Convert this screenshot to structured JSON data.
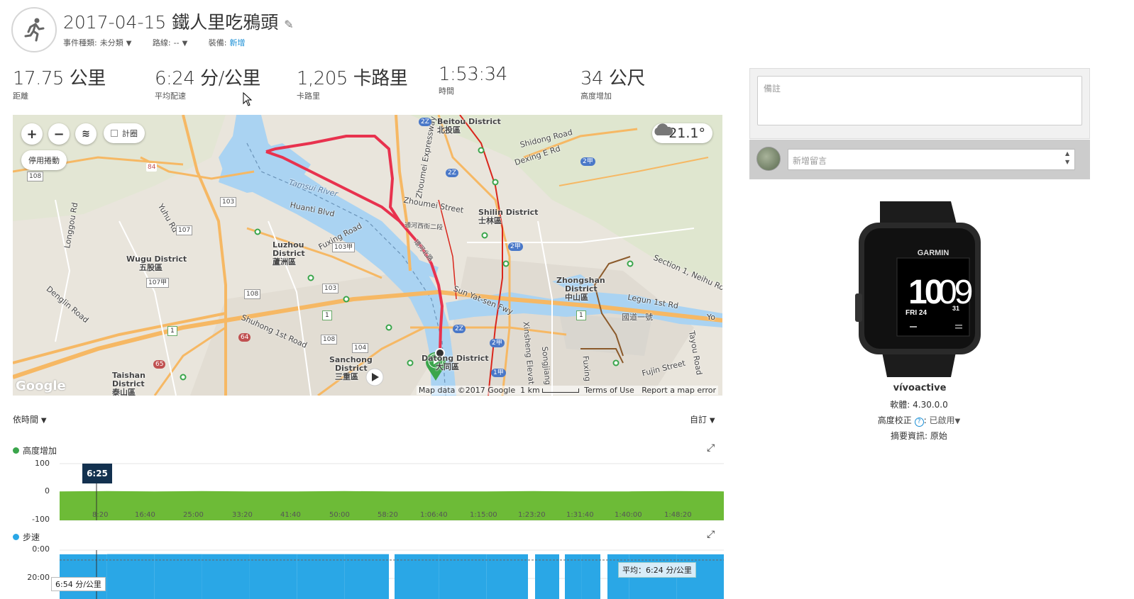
{
  "activity": {
    "title": "2017-04-15 鐵人里吃鴉頭",
    "event_type_label": "事件種類:",
    "event_type_value": "未分類",
    "route_label": "路線:",
    "route_value": "--",
    "gear_label": "裝備:",
    "gear_value": "新增"
  },
  "stats": [
    {
      "value": "17.75 公里",
      "label": "距離"
    },
    {
      "value": "6:24 分/公里",
      "label": "平均配速"
    },
    {
      "value": "1,205 卡路里",
      "label": "卡路里"
    },
    {
      "value": "1:53:34",
      "label": "時間"
    },
    {
      "value": "34 公尺",
      "label": "高度增加"
    }
  ],
  "map": {
    "checkbox_label": "計圈",
    "disable_scroll_label": "停用捲動",
    "weather_temp": "21.1°",
    "footer_data": "Map data ©2017 Google",
    "footer_scale": "1 km",
    "footer_terms": "Terms of Use",
    "footer_report": "Report a map error",
    "google_logo": "Google",
    "places": [
      {
        "name": "Beitou District",
        "sub": "北投區"
      },
      {
        "name": "Shilin District",
        "sub": "士林區"
      },
      {
        "name": "Luzhou",
        "sub": "District"
      },
      {
        "name": "蘆洲區",
        "sub": ""
      },
      {
        "name": "Wugu District",
        "sub": "五股區"
      },
      {
        "name": "Zhongshan",
        "sub": "District"
      },
      {
        "name": "中山區",
        "sub": ""
      },
      {
        "name": "Sanchong",
        "sub": "District"
      },
      {
        "name": "三重區",
        "sub": ""
      },
      {
        "name": "Taishan",
        "sub": "District"
      },
      {
        "name": "泰山區",
        "sub": ""
      },
      {
        "name": "Datong District",
        "sub": "大同區"
      }
    ],
    "roads": [
      "Tamsui River",
      "Huanti Blvd",
      "Fuxing Road",
      "Sun Yat-sen Fwy",
      "Zhoumei Street",
      "Zhoumei Expressway",
      "Shidong Road",
      "Dexing E Rd",
      "Shuhong 1st Road",
      "Denglin Road",
      "Longgou Rd",
      "Yuhu Rd",
      "Xinsheng Elevat",
      "Songjiang",
      "Fuxing",
      "Legun 1st Rd",
      "Section 1, Neihu Road",
      "國道一號",
      "Fujin Street",
      "Tayou Road",
      "通河西街二段",
      "環河北路",
      "Yo"
    ],
    "road_shields": [
      "84",
      "108",
      "103",
      "107",
      "107甲",
      "108",
      "103甲",
      "103",
      "108",
      "104",
      "65",
      "64",
      "2Z",
      "2Z",
      "2甲",
      "2Z",
      "2甲",
      "1甲",
      "2甲",
      "1",
      "1",
      "1"
    ]
  },
  "chart_controls": {
    "x_mode": "依時間",
    "customize": "自訂"
  },
  "elevation_chart": {
    "title": "高度增加",
    "color": "#5fb832",
    "cursor_label": "6:25",
    "y_ticks": [
      "100",
      "0",
      "-100"
    ],
    "x_ticks": [
      "8:20",
      "16:40",
      "25:00",
      "33:20",
      "41:40",
      "50:00",
      "58:20",
      "1:06:40",
      "1:15:00",
      "1:23:20",
      "1:31:40",
      "1:40:00",
      "1:48:20"
    ]
  },
  "pace_chart": {
    "title": "步速",
    "color": "#2aa7e6",
    "y_ticks": [
      "0:00",
      "20:00"
    ],
    "avg_label": "平均：6:24 分/公里",
    "cursor_label": "6:54 分/公里"
  },
  "chart_data": [
    {
      "type": "area",
      "title": "高度增加",
      "xlabel": "",
      "ylabel": "",
      "ylim": [
        -100,
        100
      ],
      "x": [
        "0:00",
        "8:20",
        "16:40",
        "25:00",
        "33:20",
        "41:40",
        "50:00",
        "58:20",
        "1:06:40",
        "1:15:00",
        "1:23:20",
        "1:31:40",
        "1:40:00",
        "1:48:20",
        "1:53:34"
      ],
      "series": [
        {
          "name": "高度增加",
          "values": [
            2,
            3,
            2,
            3,
            2,
            2,
            3,
            2,
            2,
            2,
            3,
            2,
            2,
            3,
            2
          ]
        }
      ]
    },
    {
      "type": "area",
      "title": "步速",
      "xlabel": "",
      "ylabel": "",
      "ylim": [
        "0:00",
        "20:00"
      ],
      "x": [
        "0:00",
        "8:20",
        "16:40",
        "25:00",
        "33:20",
        "41:40",
        "50:00",
        "58:20",
        "1:06:40",
        "1:15:00",
        "1:23:20",
        "1:31:40",
        "1:40:00",
        "1:48:20",
        "1:53:34"
      ],
      "series": [
        {
          "name": "步速",
          "values": [
            "6:54",
            "6:20",
            "6:15",
            "6:20",
            "6:18",
            "6:22",
            "6:20",
            "6:24",
            "6:30",
            "6:28",
            "6:35",
            "6:40",
            "6:30",
            "6:38",
            "6:45"
          ]
        }
      ],
      "average": "6:24 分/公里"
    }
  ],
  "notes": {
    "placeholder": "備註"
  },
  "comment": {
    "placeholder": "新增留言"
  },
  "device": {
    "name": "vívoactive",
    "brand": "GARMIN",
    "watch_time_h": "10",
    "watch_time_m": "09",
    "watch_date": "FRI 24",
    "watch_sec": "31",
    "firmware_label": "軟體:",
    "firmware_value": "4.30.0.0",
    "elev_corr_label": "高度校正",
    "elev_corr_value": "已啟用",
    "summary_label": "摘要資訊:",
    "summary_value": "原始"
  }
}
